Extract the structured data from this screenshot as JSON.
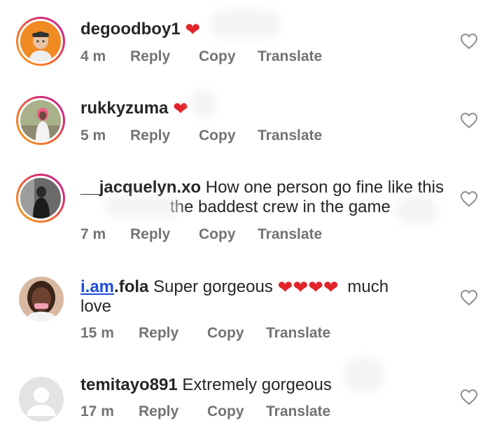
{
  "comments": [
    {
      "username": "degoodboy1",
      "text": "",
      "hearts": 1,
      "time": "4 m",
      "reply": "Reply",
      "copy": "Copy",
      "translate": "Translate"
    },
    {
      "username": "rukkyzuma",
      "text": "",
      "hearts": 1,
      "time": "5 m",
      "reply": "Reply",
      "copy": "Copy",
      "translate": "Translate"
    },
    {
      "username": "__jacquelyn.xo",
      "text": "How one person go fine like this",
      "text_line2": "the baddest crew in the game",
      "time": "7 m",
      "reply": "Reply",
      "copy": "Copy",
      "translate": "Translate"
    },
    {
      "username_link": "i.am",
      "username_rest": ".fola",
      "text": "Super gorgeous",
      "hearts": 4,
      "text_after": "much",
      "text_line2": "love",
      "time": "15 m",
      "reply": "Reply",
      "copy": "Copy",
      "translate": "Translate"
    },
    {
      "username": "temitayo891",
      "text": "Extremely gorgeous",
      "time": "17 m",
      "reply": "Reply",
      "copy": "Copy",
      "translate": "Translate"
    }
  ],
  "icons": {
    "heart": "heart-icon",
    "like": "heart-outline-icon",
    "avatar_placeholder": "default-avatar-icon"
  },
  "colors": {
    "heart": "#e3242b",
    "link": "#1d4ed8",
    "meta": "#737373",
    "text": "#262626"
  }
}
